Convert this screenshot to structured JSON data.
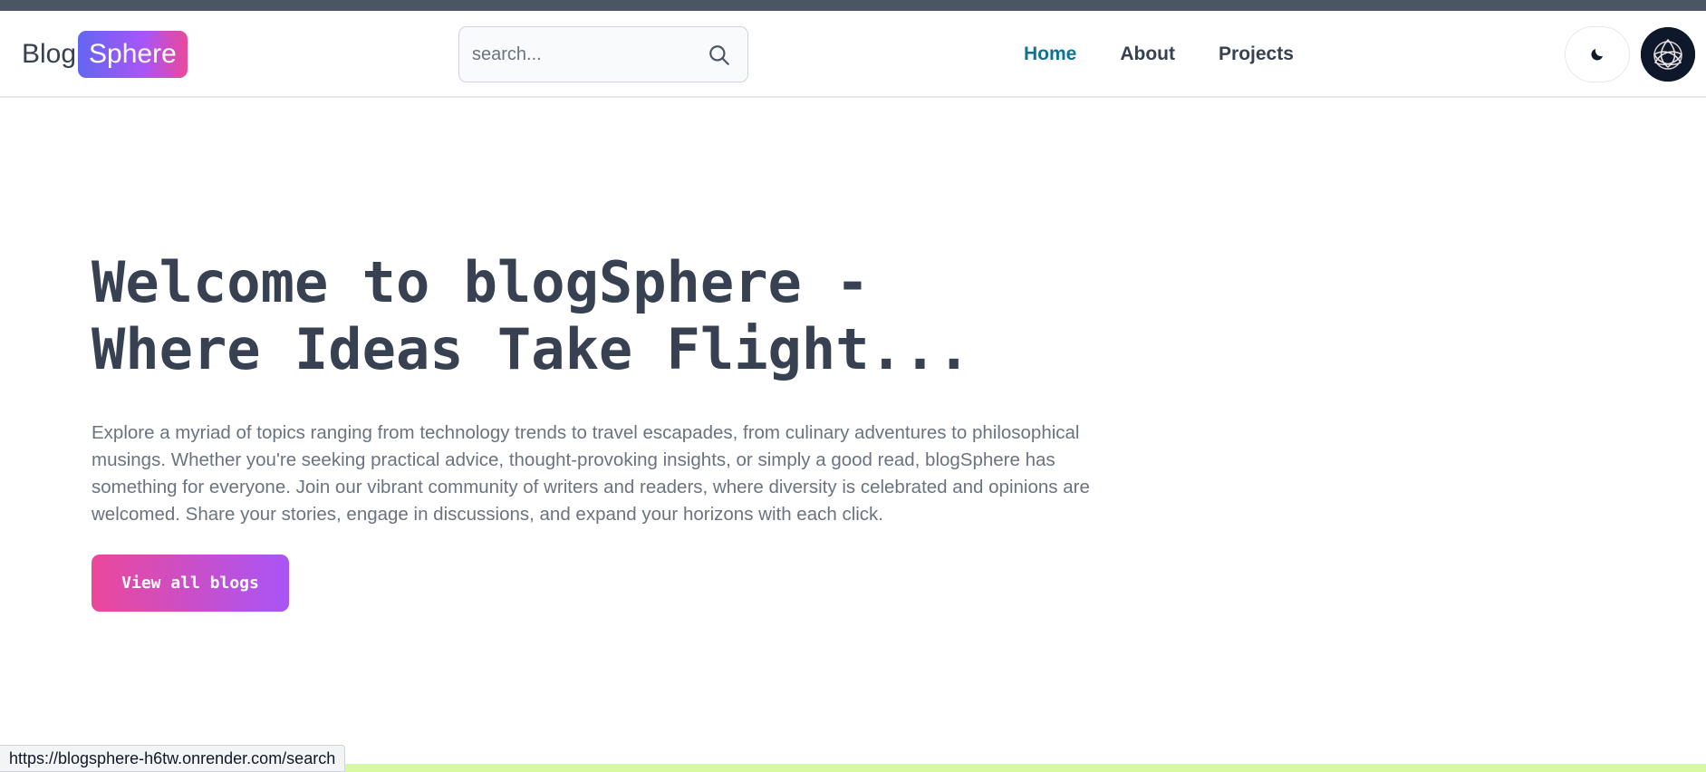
{
  "brand": {
    "part1": "Blog",
    "part2": "Sphere"
  },
  "search": {
    "placeholder": "search..."
  },
  "nav": [
    {
      "label": "Home",
      "active": true
    },
    {
      "label": "About",
      "active": false
    },
    {
      "label": "Projects",
      "active": false
    }
  ],
  "icons": {
    "search": "search-icon",
    "theme": "moon-icon",
    "avatar": "triquetra-avatar"
  },
  "hero": {
    "title": "Welcome to blogSphere - Where Ideas Take Flight...",
    "description": "Explore a myriad of topics ranging from technology trends to travel escapades, from culinary adventures to philosophical musings. Whether you're seeking practical advice, thought-provoking insights, or simply a good read, blogSphere has something for everyone. Join our vibrant community of writers and readers, where diversity is celebrated and opinions are welcomed. Share your stories, engage in discussions, and expand your horizons with each click.",
    "cta_label": "View all blogs"
  },
  "status_bar": {
    "url": "https://blogsphere-h6tw.onrender.com/search"
  },
  "colors": {
    "active_link": "#0e7490",
    "text_dark": "#374151",
    "text_muted": "#6b7280",
    "gradient_start": "#ec4899",
    "gradient_end": "#a855f7",
    "logo_gradient_start": "#6366f1",
    "top_strip": "#4b5563",
    "bottom_band": "#d9f99d"
  }
}
